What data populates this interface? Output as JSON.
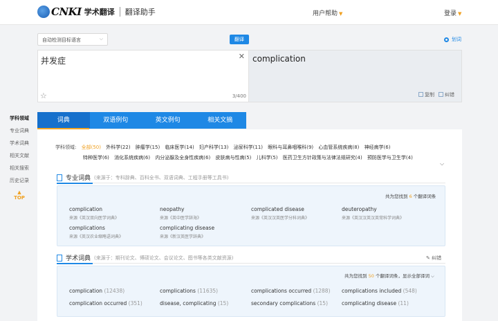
{
  "header": {
    "logo_cnki": "CNKI",
    "logo_name": "学术翻译",
    "logo_sub": "翻译助手",
    "help": "用户帮助",
    "login": "登录"
  },
  "toolbar": {
    "lang_select": "自动检测目标语言",
    "translate": "翻译",
    "word_split": "划词"
  },
  "source": {
    "text": "并发症",
    "count": "3/400"
  },
  "target": {
    "text": "complication",
    "copy": "复制",
    "correct": "纠错"
  },
  "sidebar": {
    "title": "学科领域",
    "items": [
      "专业词典",
      "学术词典",
      "相关文献",
      "相关搜索",
      "历史记录"
    ],
    "top": "TOP"
  },
  "tabs": [
    "词典",
    "双语例句",
    "英文例句",
    "相关文摘"
  ],
  "subjects": {
    "label": "学科领域:",
    "items": [
      "全部(50)",
      "外科学(22)",
      "肿瘤学(15)",
      "临床医学(14)",
      "妇产科学(13)",
      "泌尿科学(11)",
      "眼科与耳鼻咽喉科(9)",
      "心血管系统疾病(8)",
      "神经病学(6)",
      "特种医学(6)",
      "消化系统疾病(6)",
      "内分泌腺及全身性疾病(6)",
      "皮肤病与性病(5)",
      "儿科学(5)",
      "医药卫生方针政策与法律法规研究(4)",
      "预防医学与卫生学(4)"
    ]
  },
  "pro_dict": {
    "title": "专业词典",
    "source": "(来源于：专科辞典、百科全书、双语词典、工程手册等工具书)",
    "found_prefix": "共为您找到",
    "found_count": "6",
    "found_suffix": "个翻译词条",
    "entries": [
      {
        "word": "complication",
        "from": "来源《英汉双向医学词典》"
      },
      {
        "word": "neopathy",
        "from": "来源《英中医学辞海》"
      },
      {
        "word": "complicated disease",
        "from": "来源《英汉汉英医学分科词典》"
      },
      {
        "word": "deuteropathy",
        "from": "来源《英汉汉英汉英常科学词典》"
      },
      {
        "word": "complications",
        "from": "来源《英汉农业缩略语词典》"
      },
      {
        "word": "complicating disease",
        "from": "来源《新汉英医学辞典》"
      }
    ]
  },
  "acad_dict": {
    "title": "学术词典",
    "source": "(来源于：期刊论文、博硕论文、会议论文、图书等各类文献资源)",
    "edit": "纠错",
    "found_prefix": "共为您找到",
    "found_count": "50",
    "found_suffix": "个翻译词条，显示全部译词",
    "entries": [
      {
        "word": "complication",
        "count": "(12438)"
      },
      {
        "word": "complications",
        "count": "(11635)"
      },
      {
        "word": "complications occurred",
        "count": "(1288)"
      },
      {
        "word": "complications included",
        "count": "(548)"
      },
      {
        "word": "complication occurred",
        "count": "(351)"
      },
      {
        "word": "disease, complicating",
        "count": "(15)"
      },
      {
        "word": "secondary complications",
        "count": "(15)"
      },
      {
        "word": "complicating disease",
        "count": "(11)"
      }
    ]
  }
}
